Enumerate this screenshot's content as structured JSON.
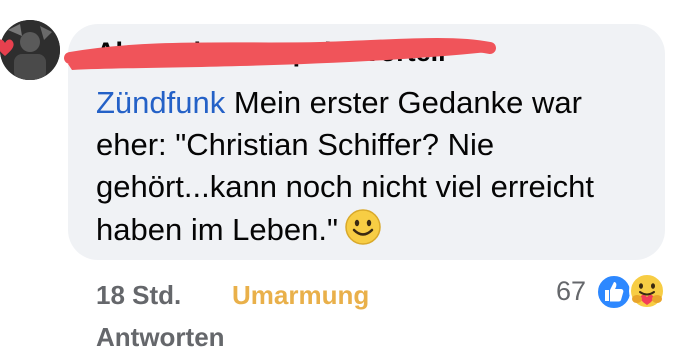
{
  "comment": {
    "author": "Alexander Praspaktovorteil",
    "mention": "Zündfunk",
    "text": " Mein erster Gedanke war eher: \"Christian Schiffer? Nie gehört...kann noch nicht viel erreicht haben im Leben.\"",
    "emoji": "slightly-smiling-face"
  },
  "footer": {
    "time": "18 Std.",
    "reaction_link": "Umarmung",
    "reply": "Antworten",
    "reaction_count": "67"
  },
  "reactions": [
    "like-icon",
    "care-icon"
  ],
  "colors": {
    "bubble": "#f0f2f5",
    "mention": "#2461c7",
    "reaction_link": "#e9b04a",
    "scribble": "#f0545a",
    "muted": "#65676b"
  }
}
